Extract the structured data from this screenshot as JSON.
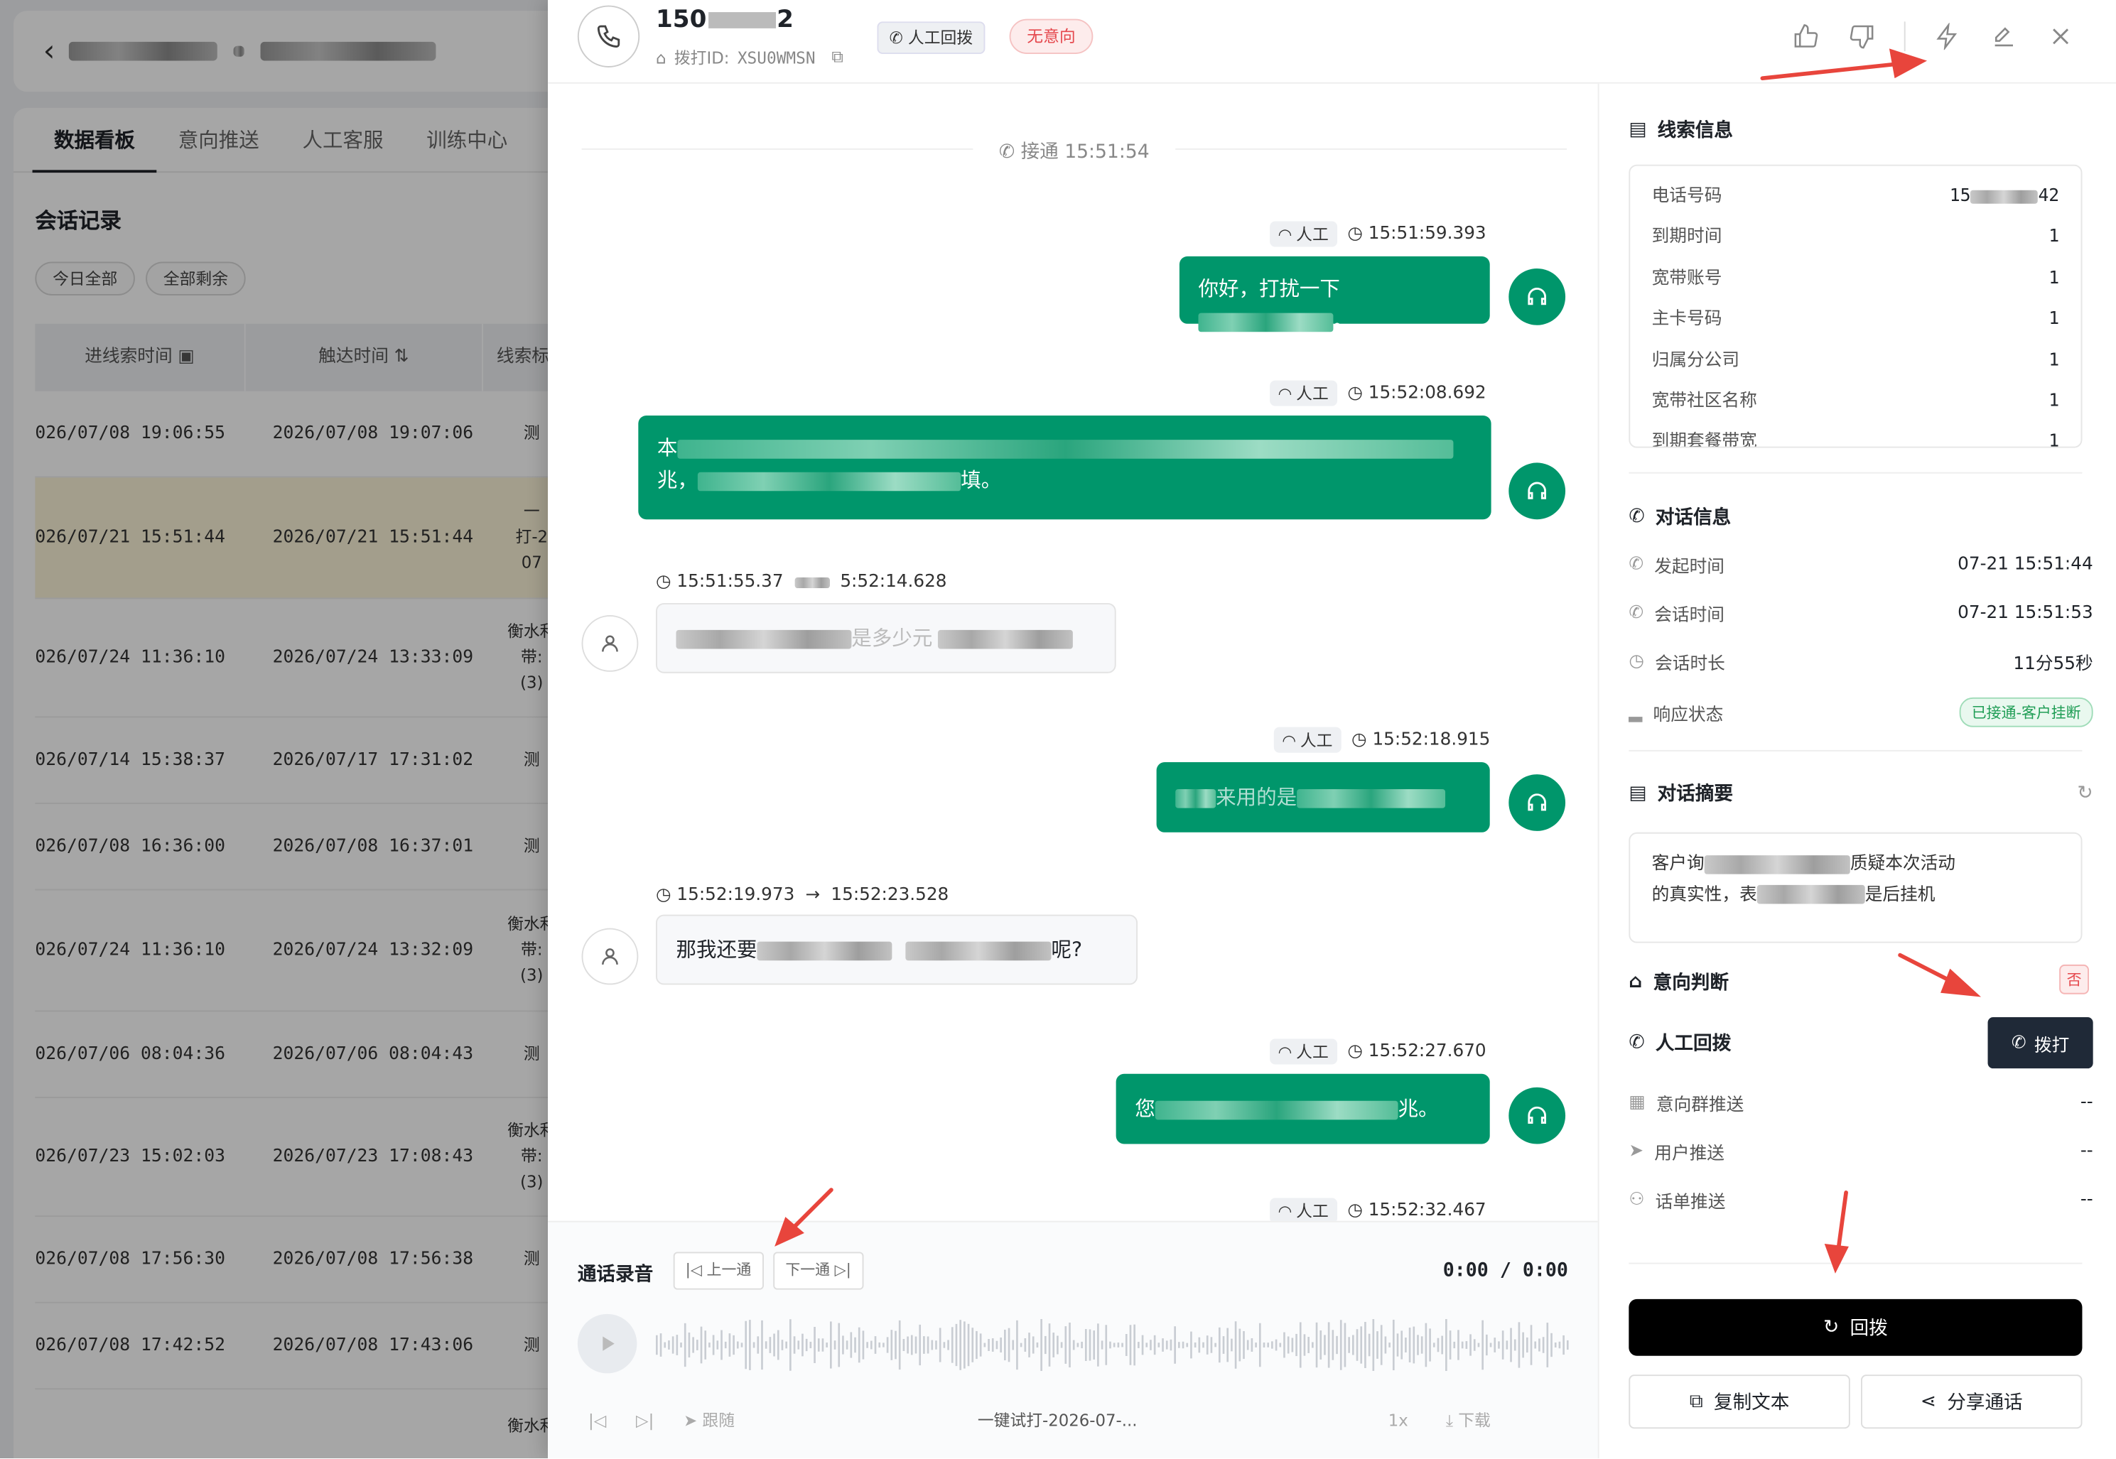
{
  "background": {
    "tabs": [
      "数据看板",
      "意向推送",
      "人工客服",
      "训练中心"
    ],
    "section_title": "会话记录",
    "chips": [
      "今日全部",
      "全部剩余"
    ],
    "columns": [
      "进线索时间",
      "触达时间",
      "线索标"
    ],
    "rows": [
      {
        "c1": "026/07/08 19:06:55",
        "c2": "2026/07/08 19:07:06",
        "c3": "测",
        "hl": false
      },
      {
        "c1": "026/07/21 15:51:44",
        "c2": "2026/07/21 15:51:44",
        "c3": "一\n打-2\n07",
        "hl": true
      },
      {
        "c1": "026/07/24 11:36:10",
        "c2": "2026/07/24 13:33:09",
        "c3": "衡水利\n带:\n(3)",
        "hl": false
      },
      {
        "c1": "026/07/14 15:38:37",
        "c2": "2026/07/17 17:31:02",
        "c3": "测",
        "hl": false
      },
      {
        "c1": "026/07/08 16:36:00",
        "c2": "2026/07/08 16:37:01",
        "c3": "测",
        "hl": false
      },
      {
        "c1": "026/07/24 11:36:10",
        "c2": "2026/07/24 13:32:09",
        "c3": "衡水利\n带:\n(3)",
        "hl": false
      },
      {
        "c1": "026/07/06 08:04:36",
        "c2": "2026/07/06 08:04:43",
        "c3": "测",
        "hl": false
      },
      {
        "c1": "026/07/23 15:02:03",
        "c2": "2026/07/23 17:08:43",
        "c3": "衡水利\n带:\n(3)",
        "hl": false
      },
      {
        "c1": "026/07/08 17:56:30",
        "c2": "2026/07/08 17:56:38",
        "c3": "测",
        "hl": false
      },
      {
        "c1": "026/07/08 17:42:52",
        "c2": "2026/07/08 17:43:06",
        "c3": "测",
        "hl": false
      },
      {
        "c1": "",
        "c2": "",
        "c3": "衡水利",
        "hl": false
      }
    ]
  },
  "header": {
    "phone_prefix": "150",
    "phone_suffix": "2",
    "dial_id_label": "拨打ID:",
    "dial_id": "XSU0WMSN",
    "tag_manual": "人工回拨",
    "tag_intent": "无意向"
  },
  "chat": {
    "connect": "接通 15:51:54",
    "agent_label": "人工",
    "messages": [
      {
        "time": "15:51:59.393",
        "text_a": "你好，打扰一下",
        "text_b": "。"
      },
      {
        "time": "15:52:08.692",
        "text_a": "本",
        "text_b": "兆，",
        "text_c": "填。"
      },
      {
        "time": "15:51:55.37",
        "time2": "5:52:14.628",
        "text_a": "",
        "text_b": "是多少元"
      },
      {
        "time": "15:52:18.915",
        "text_a": "来用的是"
      },
      {
        "time": "15:52:19.973",
        "time2": "15:52:23.528",
        "text_a": "那我还要",
        "text_b": "呢?"
      },
      {
        "time": "15:52:27.670",
        "text_a": "您",
        "text_b": "兆。"
      },
      {
        "time": "15:52:32.467"
      }
    ]
  },
  "audio": {
    "title": "通话录音",
    "prev": "上一通",
    "next": "下一通",
    "time": "0:00 / 0:00",
    "follow": "跟随",
    "filename": "一键试打-2026-07-...",
    "speed": "1x",
    "download": "下载"
  },
  "panel": {
    "lead_title": "线索信息",
    "lead_rows": [
      {
        "k": "电话号码",
        "v": "15",
        "v2": "42"
      },
      {
        "k": "到期时间",
        "v": "1"
      },
      {
        "k": "宽带账号",
        "v": "1"
      },
      {
        "k": "主卡号码",
        "v": "1"
      },
      {
        "k": "归属分公司",
        "v": "1"
      },
      {
        "k": "宽带社区名称",
        "v": "1"
      },
      {
        "k": "到期套餐带宽",
        "v": "1"
      }
    ],
    "dialog_title": "对话信息",
    "dialog_rows": [
      {
        "k": "发起时间",
        "v": "07-21 15:51:44"
      },
      {
        "k": "会话时间",
        "v": "07-21 15:51:53"
      },
      {
        "k": "会话时长",
        "v": "11分55秒"
      },
      {
        "k": "响应状态",
        "v": "已接通-客户挂断"
      }
    ],
    "summary_title": "对话摘要",
    "summary_a": "客户询",
    "summary_b": "质疑本次活动",
    "summary_c": "的真实性，表",
    "summary_d": "是后挂机",
    "intent_title": "意向判断",
    "intent_value": "否",
    "callback_title": "人工回拨",
    "dial_button": "拨打",
    "push_rows": [
      {
        "k": "意向群推送",
        "v": "--"
      },
      {
        "k": "用户推送",
        "v": "--"
      },
      {
        "k": "话单推送",
        "v": "--"
      }
    ],
    "redial": "回拨",
    "copy": "复制文本",
    "share": "分享通话"
  },
  "colors": {
    "green": "#00966b",
    "dark": "#1f2937",
    "red": "#e5484d",
    "arrow": "#e8453c"
  }
}
